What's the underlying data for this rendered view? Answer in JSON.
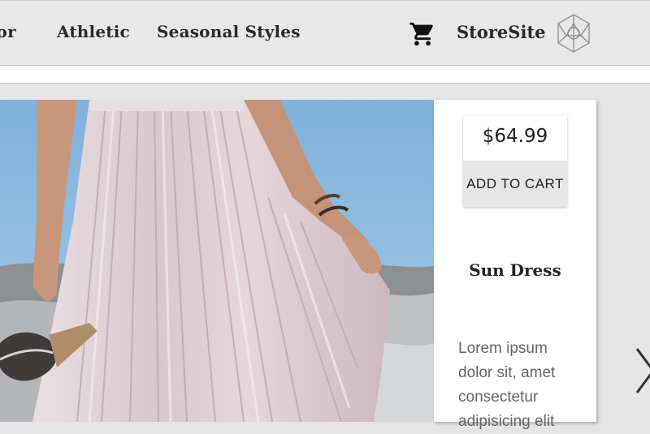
{
  "nav": {
    "items": [
      {
        "label": "Outdoor",
        "visible": "oor"
      },
      {
        "label": "Athletic"
      },
      {
        "label": "Seasonal Styles"
      }
    ],
    "cart_icon": "shopping-cart-icon",
    "brand": "StoreSite",
    "logo_icon": "geometric-logo-icon"
  },
  "product": {
    "price": "$64.99",
    "add_to_cart": "ADD TO CART",
    "title": "Sun Dress",
    "description": "Lorem ipsum dolor sit, amet consectetur adipisicing elit"
  },
  "carousel": {
    "next_icon": "chevron-right-icon"
  },
  "colors": {
    "navbar_bg": "#e8e8e8",
    "page_bg": "#e5e5e5",
    "card_bg": "#ffffff",
    "button_bg": "#e6e6e6"
  }
}
